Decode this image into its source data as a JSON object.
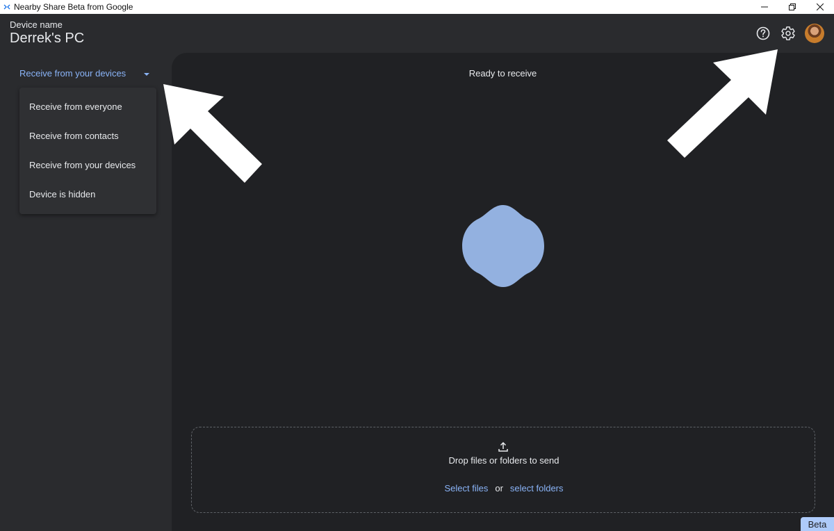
{
  "window": {
    "title": "Nearby Share Beta from Google",
    "icon": "nearby-share-icon"
  },
  "header": {
    "device_label": "Device name",
    "device_name": "Derrek's PC",
    "help_icon": "help-icon",
    "settings_icon": "gear-icon"
  },
  "sidebar": {
    "visibility_selected": "Receive from your devices",
    "menu_items": [
      "Receive from everyone",
      "Receive from contacts",
      "Receive from your devices",
      "Device is hidden"
    ]
  },
  "main": {
    "status": "Ready to receive",
    "drop_text": "Drop files or folders to send",
    "select_files": "Select files",
    "or": "or",
    "select_folders": "select folders",
    "beta": "Beta"
  },
  "colors": {
    "accent": "#8ab4f8",
    "blob": "#93b1e0",
    "beta_bg": "#aecbfa",
    "panel": "#202124",
    "sidebar": "#2a2b2e"
  }
}
